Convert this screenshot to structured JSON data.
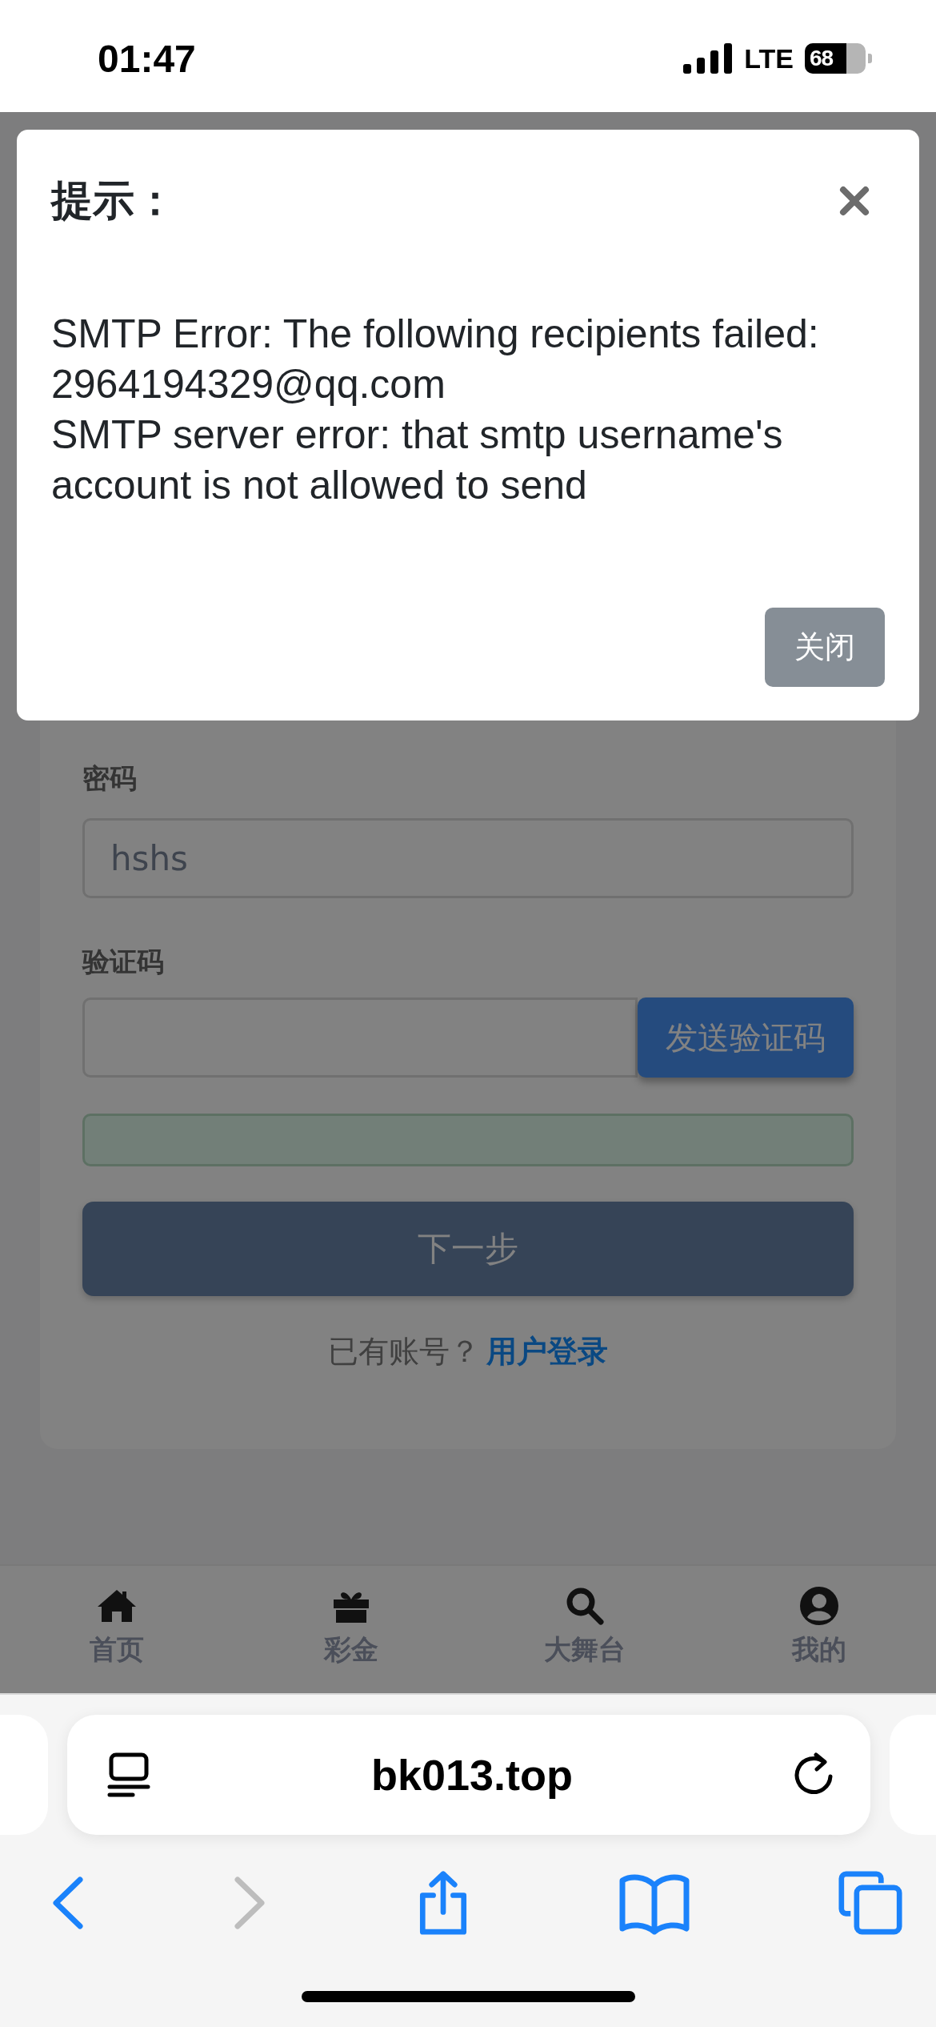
{
  "status_bar": {
    "time": "01:47",
    "network": "LTE",
    "battery": "68"
  },
  "dialog": {
    "title": "提示：",
    "messages": [
      "SMTP Error: The following recipients failed: 2964194329@qq.com",
      "SMTP server error: that smtp username's account is not allowed to send"
    ],
    "button": "关闭"
  },
  "form": {
    "fields": [
      {
        "kind": "text",
        "label": "密码",
        "value": "hshs"
      },
      {
        "kind": "code",
        "label": "验证码",
        "button": "发送验证码"
      }
    ],
    "submit": "下一步",
    "login_prompt": "已有账号？",
    "login_link": "用户登录"
  },
  "tab_bar": [
    {
      "label": "首页"
    },
    {
      "label": "彩金"
    },
    {
      "label": "大舞台"
    },
    {
      "label": "我的"
    }
  ],
  "browser": {
    "url": "bk013.top"
  }
}
